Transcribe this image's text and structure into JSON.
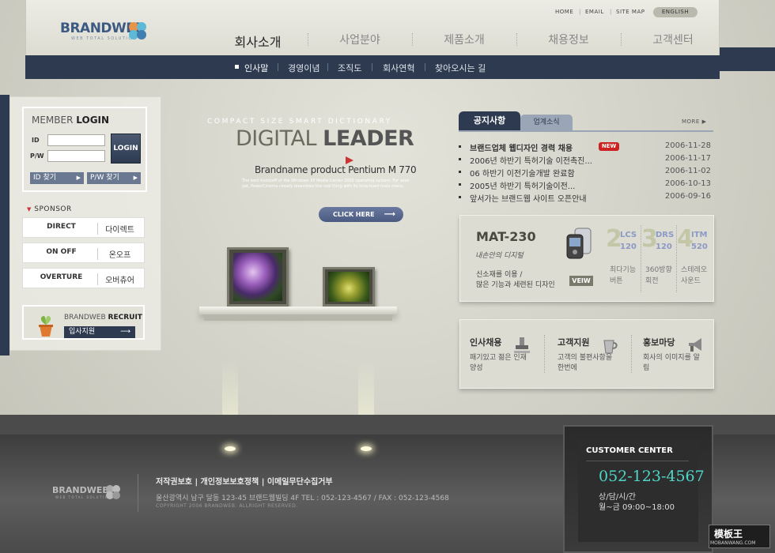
{
  "header": {
    "logo_text": "BRANDWEB",
    "logo_sub": "WEB TOTAL SOLUTION",
    "util_links": [
      "HOME",
      "EMAIL",
      "SITE MAP"
    ],
    "util_english": "ENGLISH",
    "gnb": [
      "회사소개",
      "사업분야",
      "제품소개",
      "채용정보",
      "고객센터"
    ]
  },
  "subnav": [
    "인사말",
    "경영이념",
    "조직도",
    "회사연혁",
    "찾아오시는 길"
  ],
  "login": {
    "title_light": "MEMBER",
    "title_bold": "LOGIN",
    "id_label": "ID",
    "pw_label": "P/W",
    "login_button": "LOGIN",
    "find_id": "ID 찾기",
    "find_pw": "P/W 찾기"
  },
  "sponsor": {
    "title": "SPONSOR",
    "items": [
      {
        "logo": "DIRECT",
        "name": "다이렉트"
      },
      {
        "logo": "ON OFF",
        "name": "온오프"
      },
      {
        "logo": "OVERTURE",
        "name": "오버츄어"
      }
    ]
  },
  "recruit": {
    "title_light": "BRANDWEB",
    "title_bold": "RECRUIT",
    "button": "입사지원"
  },
  "hero": {
    "subtitle": "COMPACT SIZE SMART DICTIONARY",
    "title_light": "DIGITAL",
    "title_bold": "LEADER",
    "caption": "Brandname product Pentium M 770",
    "desc": "The best knockoff of the Windows XP Media Center 2005 operating system. For soon yet, PowerCinema closely resembles the real thing with its blue-hued main menu.",
    "click_here": "CLICK HERE"
  },
  "notice": {
    "tab_active": "공지사항",
    "tab_inactive": "업계소식",
    "more": "MORE",
    "new_badge": "NEW",
    "items": [
      {
        "title": "브랜드업체 웹디자인 경력 채용",
        "date": "2006-11-28"
      },
      {
        "title": "2006년 하반기 특허기술 이전촉진...",
        "date": "2006-11-17"
      },
      {
        "title": "06 하반기 이전기술개발 완료함",
        "date": "2006-11-02"
      },
      {
        "title": "2005년 하반기 특허기술이전...",
        "date": "2006-10-13"
      },
      {
        "title": "앞서가는 브랜드웹 사이트 오픈안내",
        "date": "2006-09-16"
      }
    ]
  },
  "product": {
    "name": "MAT-230",
    "script": "내손안의 디지털",
    "desc_line1": "신소재를 이용 /",
    "desc_line2": "많은 기능과 세련된 디자인",
    "view_button": "VEIW",
    "features": [
      {
        "num": "2",
        "code": "LCS 120",
        "label": "최다기능 버튼"
      },
      {
        "num": "3",
        "code": "DRS 120",
        "label": "360방향 회전"
      },
      {
        "num": "4",
        "code": "ITM 520",
        "label": "스테레오 사운드"
      }
    ]
  },
  "services": [
    {
      "title": "인사채용",
      "desc": "패기있고 젊은 인재 양성"
    },
    {
      "title": "고객지원",
      "desc": "고객의 불편사항을 한번에"
    },
    {
      "title": "홍보마당",
      "desc": "회사의 이미지를 알림"
    }
  ],
  "footer": {
    "logo_text": "BRANDWEB",
    "logo_sub": "WEB TOTAL SOLUTION",
    "links": "저작권보호  |  개인정보보호정책  |  이메일무단수집거부",
    "address": "울산광역시 남구 달동 123-45  브랜드웹빌딩 4F    TEL : 052-123-4567  /  FAX : 052-123-4568",
    "copyright": "COPYRIGHT 2006 BRANDWEB. ALLRIGHT RESERVED."
  },
  "customer_center": {
    "title": "CUSTOMER CENTER",
    "phone": "052-123-4567",
    "label": "상/담/시/간",
    "hours": "월~금 09:00~18:00"
  },
  "watermark": {
    "name": "模板王",
    "url": "MOBANWANG.COM"
  },
  "colors": {
    "navy": "#2d3a50",
    "accent_red": "#cc2222",
    "phone_teal": "#4fd6c8"
  }
}
